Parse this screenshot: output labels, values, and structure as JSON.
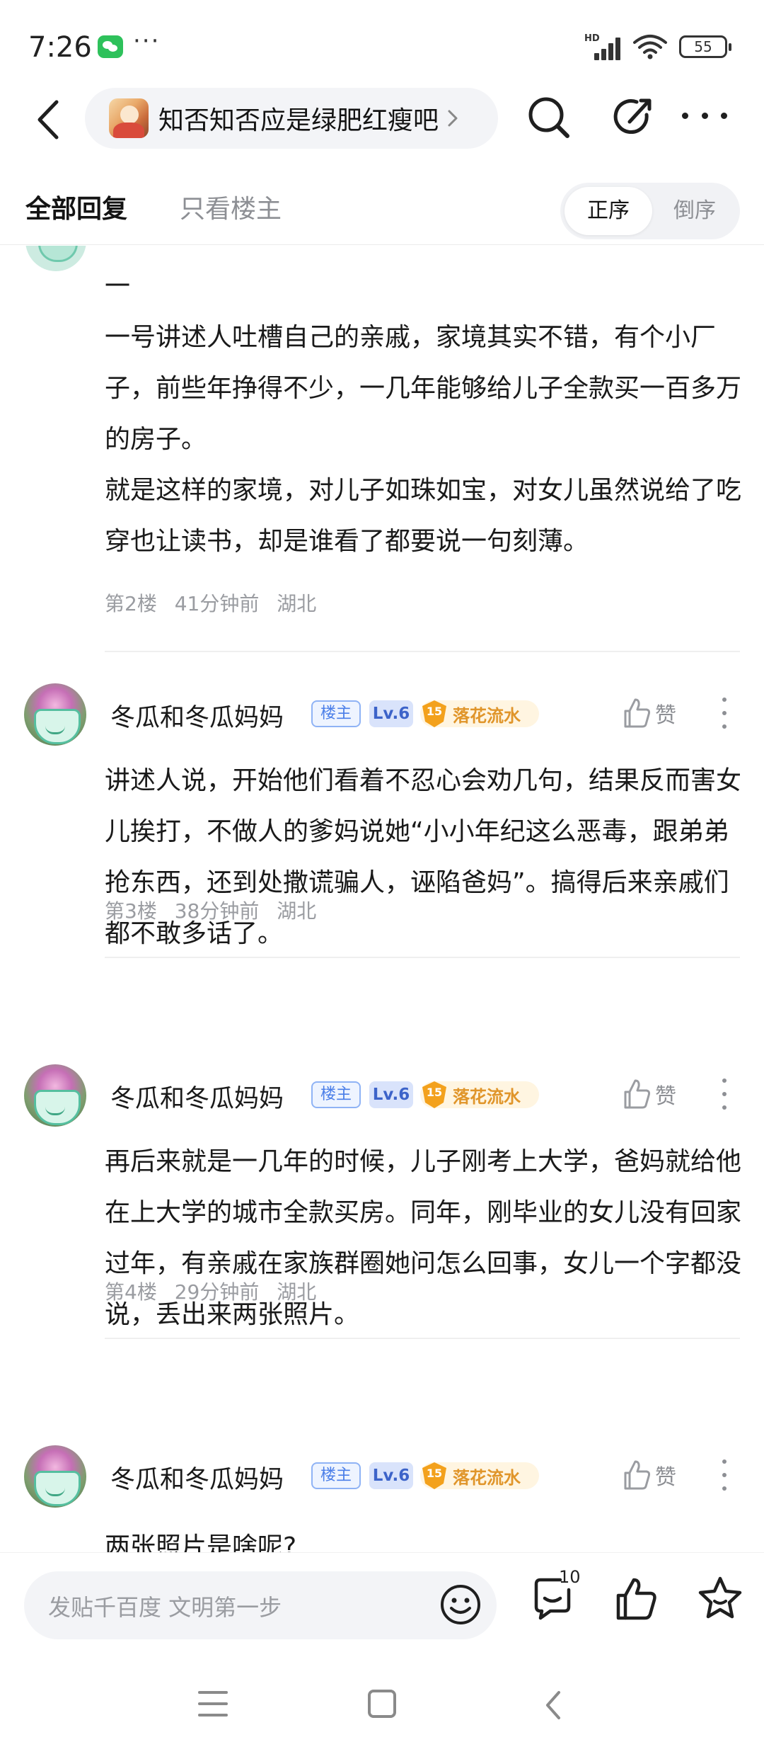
{
  "status_bar": {
    "time": "7:26",
    "network": "HD",
    "battery": "55",
    "icons": [
      "wechat-icon",
      "signal-icon",
      "wifi-icon",
      "battery-icon"
    ]
  },
  "header": {
    "forum_name": "知否知否应是绿肥红瘦吧",
    "icons": [
      "back-icon",
      "chevron-right-icon",
      "search-icon",
      "edit-icon",
      "more-icon"
    ]
  },
  "tabs": {
    "all_replies": "全部回复",
    "only_op": "只看楼主",
    "sort_asc": "正序",
    "sort_desc": "倒序"
  },
  "posts": [
    {
      "text": "一\n一号讲述人吐槽自己的亲戚，家境其实不错，有个小厂子，前些年挣得不少，一几年能够给儿子全款买一百多万的房子。\n就是这样的家境，对儿子如珠如宝，对女儿虽然说给了吃穿也让读书，却是谁看了都要说一句刻薄。",
      "floor": "第2楼",
      "time": "41分钟前",
      "location": "湖北"
    },
    {
      "username": "冬瓜和冬瓜妈妈",
      "op_badge": "楼主",
      "level": "Lv.6",
      "title_level": "15",
      "title": "落花流水",
      "like_label": "赞",
      "text": "讲述人说，开始他们看着不忍心会劝几句，结果反而害女儿挨打，不做人的爹妈说她“小小年纪这么恶毒，跟弟弟抢东西，还到处撒谎骗人，诬陷爸妈”。搞得后来亲戚们都不敢多话了。",
      "floor": "第3楼",
      "time": "38分钟前",
      "location": "湖北"
    },
    {
      "username": "冬瓜和冬瓜妈妈",
      "op_badge": "楼主",
      "level": "Lv.6",
      "title_level": "15",
      "title": "落花流水",
      "like_label": "赞",
      "text": "再后来就是一几年的时候，儿子刚考上大学，爸妈就给他在上大学的城市全款买房。同年，刚毕业的女儿没有回家过年，有亲戚在家族群圈她问怎么回事，女儿一个字都没说，丢出来两张照片。",
      "floor": "第4楼",
      "time": "29分钟前",
      "location": "湖北"
    },
    {
      "username": "冬瓜和冬瓜妈妈",
      "op_badge": "楼主",
      "level": "Lv.6",
      "title_level": "15",
      "title": "落花流水",
      "like_label": "赞",
      "text": "两张照片是啥呢?"
    }
  ],
  "bottom_bar": {
    "reply_placeholder": "发贴千百度 文明第一步",
    "comment_count": "10",
    "icons": [
      "emoji-icon",
      "comment-icon",
      "thumbs-up-icon",
      "star-icon"
    ]
  },
  "nav_bar": {
    "icons": [
      "menu-icon",
      "home-icon",
      "back-icon"
    ]
  },
  "colors": {
    "accent_blue": "#4a7ee8",
    "title_orange": "#e0952a",
    "muted_text": "#9a9ca1"
  }
}
